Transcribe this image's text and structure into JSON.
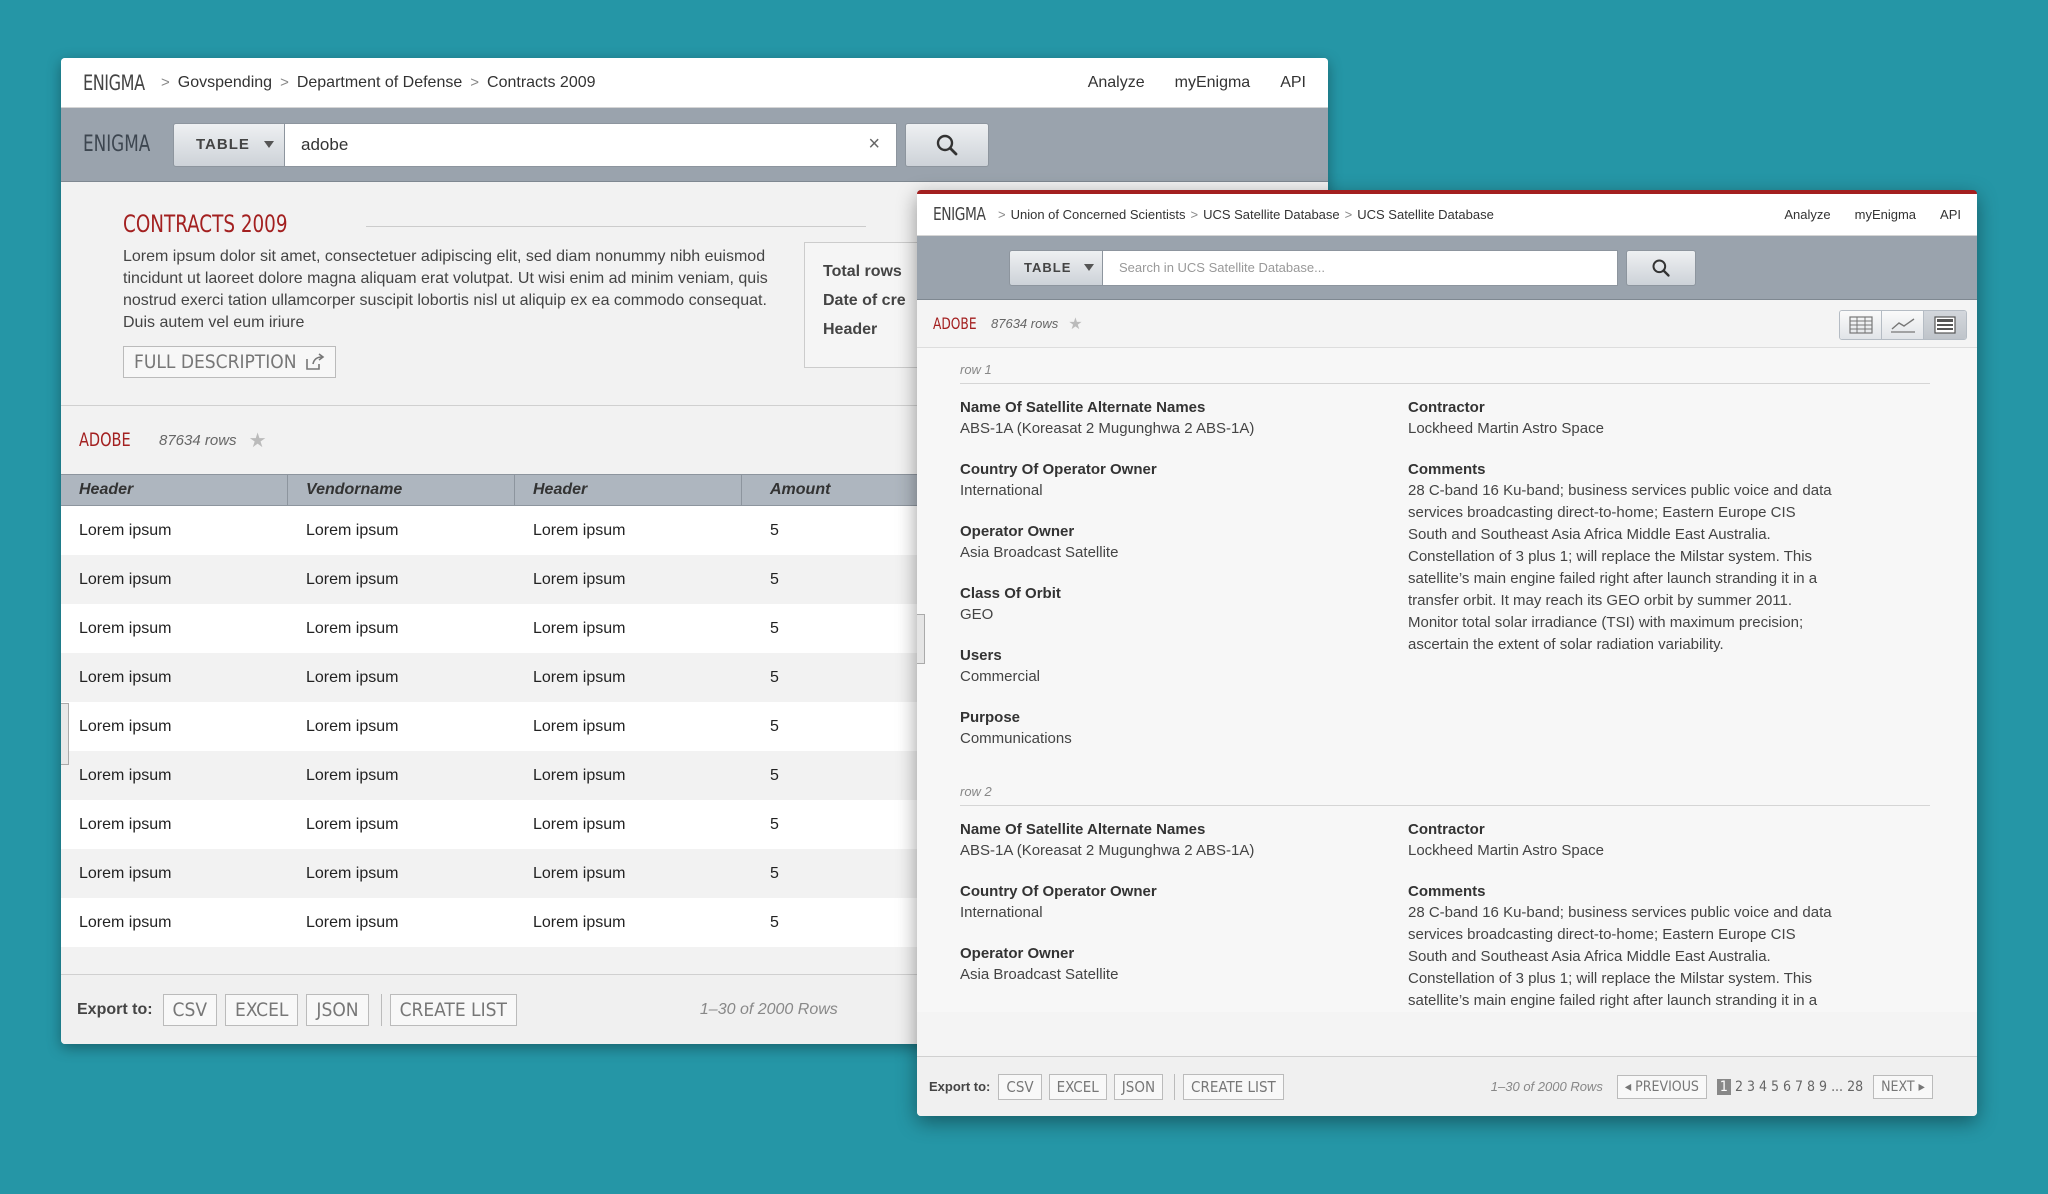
{
  "win1": {
    "logo": "ENIGMA",
    "breadcrumbs": [
      "Govspending",
      "Department of Defense",
      "Contracts 2009"
    ],
    "topnav": [
      "Analyze",
      "myEnigma",
      "API"
    ],
    "search": {
      "logo": "ENIGMA",
      "type_label": "TABLE",
      "value": "adobe",
      "clear": "×"
    },
    "title": "CONTRACTS 2009",
    "description": "Lorem ipsum dolor sit amet, consectetuer adipiscing elit, sed diam nonummy nibh euismod tincidunt ut laoreet dolore magna aliquam erat volutpat. Ut wisi enim ad minim veniam, quis nostrud exerci tation ullamcorper suscipit lobortis nisl ut aliquip ex ea commodo consequat. Duis autem vel eum iriure",
    "full_description_label": "FULL DESCRIPTION",
    "info": [
      "Total rows",
      "Date of cre",
      "Header"
    ],
    "table": {
      "name": "ADOBE",
      "count": "87634 rows",
      "columns": [
        "Header",
        "Vendorname",
        "Header",
        "Amount"
      ],
      "rows": [
        [
          "Lorem ipsum",
          "Lorem ipsum",
          "Lorem ipsum",
          "5"
        ],
        [
          "Lorem ipsum",
          "Lorem ipsum",
          "Lorem ipsum",
          "5"
        ],
        [
          "Lorem ipsum",
          "Lorem ipsum",
          "Lorem ipsum",
          "5"
        ],
        [
          "Lorem ipsum",
          "Lorem ipsum",
          "Lorem ipsum",
          "5"
        ],
        [
          "Lorem ipsum",
          "Lorem ipsum",
          "Lorem ipsum",
          "5"
        ],
        [
          "Lorem ipsum",
          "Lorem ipsum",
          "Lorem ipsum",
          "5"
        ],
        [
          "Lorem ipsum",
          "Lorem ipsum",
          "Lorem ipsum",
          "5"
        ],
        [
          "Lorem ipsum",
          "Lorem ipsum",
          "Lorem ipsum",
          "5"
        ],
        [
          "Lorem ipsum",
          "Lorem ipsum",
          "Lorem ipsum",
          "5"
        ]
      ]
    },
    "footer": {
      "export_label": "Export to:",
      "csv": "CSV",
      "excel": "EXCEL",
      "json": "JSON",
      "create_list": "CREATE LIST",
      "rows_info": "1–30 of 2000 Rows"
    }
  },
  "win2": {
    "logo": "ENIGMA",
    "breadcrumbs": [
      "Union of Concerned Scientists",
      "UCS Satellite Database",
      "UCS Satellite Database"
    ],
    "topnav": [
      "Analyze",
      "myEnigma",
      "API"
    ],
    "search": {
      "type_label": "TABLE",
      "placeholder": "Search in UCS Satellite Database..."
    },
    "table": {
      "name": "ADOBE",
      "count": "87634 rows"
    },
    "rows": [
      {
        "label": "row 1",
        "left": [
          {
            "label": "Name Of Satellite Alternate Names",
            "value": "ABS-1A (Koreasat 2 Mugunghwa 2 ABS-1A)"
          },
          {
            "label": "Country Of Operator Owner",
            "value": "International"
          },
          {
            "label": "Operator Owner",
            "value": "Asia Broadcast Satellite"
          },
          {
            "label": "Class Of Orbit",
            "value": "GEO"
          },
          {
            "label": "Users",
            "value": "Commercial"
          },
          {
            "label": "Purpose",
            "value": "Communications"
          }
        ],
        "right": [
          {
            "label": "Contractor",
            "value": "Lockheed Martin Astro Space"
          },
          {
            "label": "Comments",
            "value": "28 C-band 16 Ku-band; business services public voice and data services broadcasting direct-to-home; Eastern Europe CIS South and Southeast Asia Africa Middle East Australia. Constellation of 3 plus 1; will replace the Milstar system. This satellite’s main engine failed right after launch stranding it in a transfer orbit. It may reach its GEO orbit by summer 2011. Monitor total solar irradiance (TSI) with maximum precision; ascertain the extent of solar radiation variability."
          }
        ]
      },
      {
        "label": "row 2",
        "left": [
          {
            "label": "Name Of Satellite Alternate Names",
            "value": "ABS-1A (Koreasat 2 Mugunghwa 2 ABS-1A)"
          },
          {
            "label": "Country Of Operator Owner",
            "value": "International"
          },
          {
            "label": "Operator Owner",
            "value": "Asia Broadcast Satellite"
          }
        ],
        "right": [
          {
            "label": "Contractor",
            "value": "Lockheed Martin Astro Space"
          },
          {
            "label": "Comments",
            "value": "28 C-band 16 Ku-band; business services public voice and data services broadcasting direct-to-home; Eastern Europe CIS South and Southeast Asia Africa Middle East Australia. Constellation of 3 plus 1; will replace the Milstar system. This satellite’s main engine failed right after launch stranding it in a transfer orbit."
          }
        ]
      }
    ],
    "footer": {
      "export_label": "Export to:",
      "csv": "CSV",
      "excel": "EXCEL",
      "json": "JSON",
      "create_list": "CREATE LIST",
      "rows_info": "1–30 of 2000 Rows",
      "previous": "PREVIOUS",
      "next": "NEXT",
      "pages": [
        "1",
        "2",
        "3",
        "4",
        "5",
        "6",
        "7",
        "8",
        "9",
        "...",
        "28"
      ]
    }
  }
}
